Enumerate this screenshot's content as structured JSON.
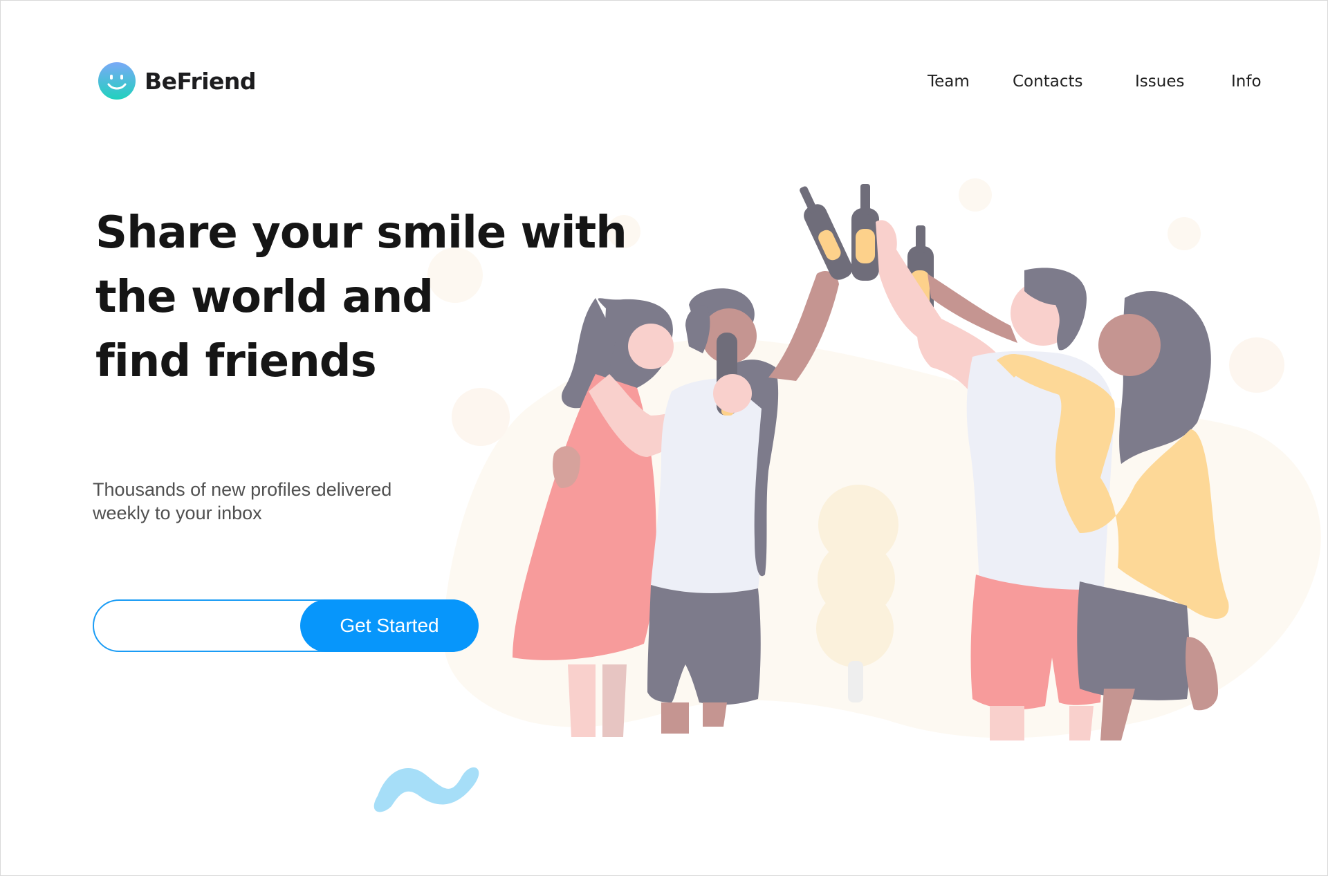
{
  "brand": {
    "name": "BeFriend",
    "icon": "smiley-face-logo-icon"
  },
  "nav": {
    "items": [
      "Team",
      "Contacts",
      "Issues",
      "Info"
    ]
  },
  "hero": {
    "headline_lines": [
      "Share your smile with",
      "the world and",
      "find friends"
    ],
    "subtext_lines": [
      "Thousands of new profiles delivered",
      "weekly to your inbox"
    ]
  },
  "signup": {
    "input_value": "",
    "button_label": "Get Started"
  },
  "illustration": {
    "subject": "friends-toasting-bottles"
  },
  "colors": {
    "accent": "#0796fb",
    "input_border": "#1a9cf5",
    "logo_gradient": [
      "#7aa9f7",
      "#20d1bd"
    ],
    "blob": "#fdf9f2",
    "squiggle": "#a6def8",
    "hair": "#7d7b8b",
    "dress": "#f79b9b",
    "skin_light": "#f9d0cc",
    "skin_dark": "#c59591",
    "shirt": "#edeff7",
    "jacket": "#fdd897",
    "bottle": "#6f6d7a",
    "label": "#fdd18b"
  }
}
